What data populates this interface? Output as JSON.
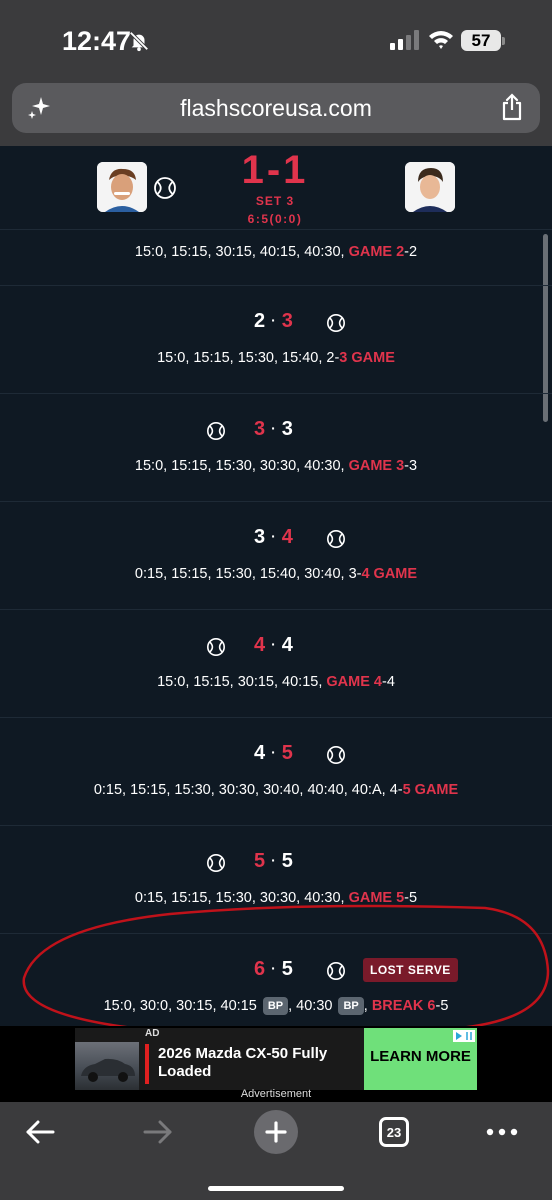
{
  "status_bar": {
    "time": "12:47",
    "battery": "57"
  },
  "browser": {
    "url": "flashscoreusa.com"
  },
  "match": {
    "score": "1-1",
    "set_label": "SET 3",
    "set_score": "6:5(0:0)"
  },
  "games": [
    {
      "pbp": [
        {
          "text": "15:0, 15:15, 30:15, 40:15, 40:30, "
        },
        {
          "text": "GAME 2",
          "red": true
        },
        {
          "text": "-2"
        }
      ]
    },
    {
      "left": "2",
      "right": "3",
      "red_side": "right",
      "serve": "right",
      "pbp": [
        {
          "text": "15:0, 15:15, 15:30, 15:40, 2-"
        },
        {
          "text": "3 GAME",
          "red": true
        }
      ]
    },
    {
      "left": "3",
      "right": "3",
      "red_side": "left",
      "serve": "left",
      "pbp": [
        {
          "text": "15:0, 15:15, 15:30, 30:30, 40:30, "
        },
        {
          "text": "GAME 3",
          "red": true
        },
        {
          "text": "-3"
        }
      ]
    },
    {
      "left": "3",
      "right": "4",
      "red_side": "right",
      "serve": "right",
      "pbp": [
        {
          "text": "0:15, 15:15, 15:30, 15:40, 30:40, 3-"
        },
        {
          "text": "4 GAME",
          "red": true
        }
      ]
    },
    {
      "left": "4",
      "right": "4",
      "red_side": "left",
      "serve": "left",
      "pbp": [
        {
          "text": "15:0, 15:15, 30:15, 40:15, "
        },
        {
          "text": "GAME 4",
          "red": true
        },
        {
          "text": "-4"
        }
      ]
    },
    {
      "left": "4",
      "right": "5",
      "red_side": "right",
      "serve": "right",
      "pbp": [
        {
          "text": "0:15, 15:15, 15:30, 30:30, 30:40, 40:40, 40:A, 4-"
        },
        {
          "text": "5 GAME",
          "red": true
        }
      ]
    },
    {
      "left": "5",
      "right": "5",
      "red_side": "left",
      "serve": "left",
      "pbp": [
        {
          "text": "0:15, 15:15, 15:30, 30:30, 40:30, "
        },
        {
          "text": "GAME 5",
          "red": true
        },
        {
          "text": "-5"
        }
      ]
    },
    {
      "left": "6",
      "right": "5",
      "red_side": "left",
      "serve": "right",
      "badge": "LOST SERVE",
      "pbp": [
        {
          "text": "15:0, 30:0, 30:15, 40:15 "
        },
        {
          "badge": "BP"
        },
        {
          "text": ", 40:30 "
        },
        {
          "badge": "BP"
        },
        {
          "text": ", "
        },
        {
          "text": "BREAK 6",
          "red": true
        },
        {
          "text": "-5"
        }
      ]
    }
  ],
  "ad": {
    "label": "AD",
    "title": "2026 Mazda CX-50 Fully Loaded",
    "cta": "LEARN MORE",
    "footer": "Advertisement"
  },
  "toolbar": {
    "tab_count": "23"
  },
  "colors": {
    "accent_red": "#e0344c",
    "background": "#0f1923",
    "chrome": "#3b3b3d",
    "annotation": "#c0121a",
    "ad_cta": "#6fe07a"
  }
}
